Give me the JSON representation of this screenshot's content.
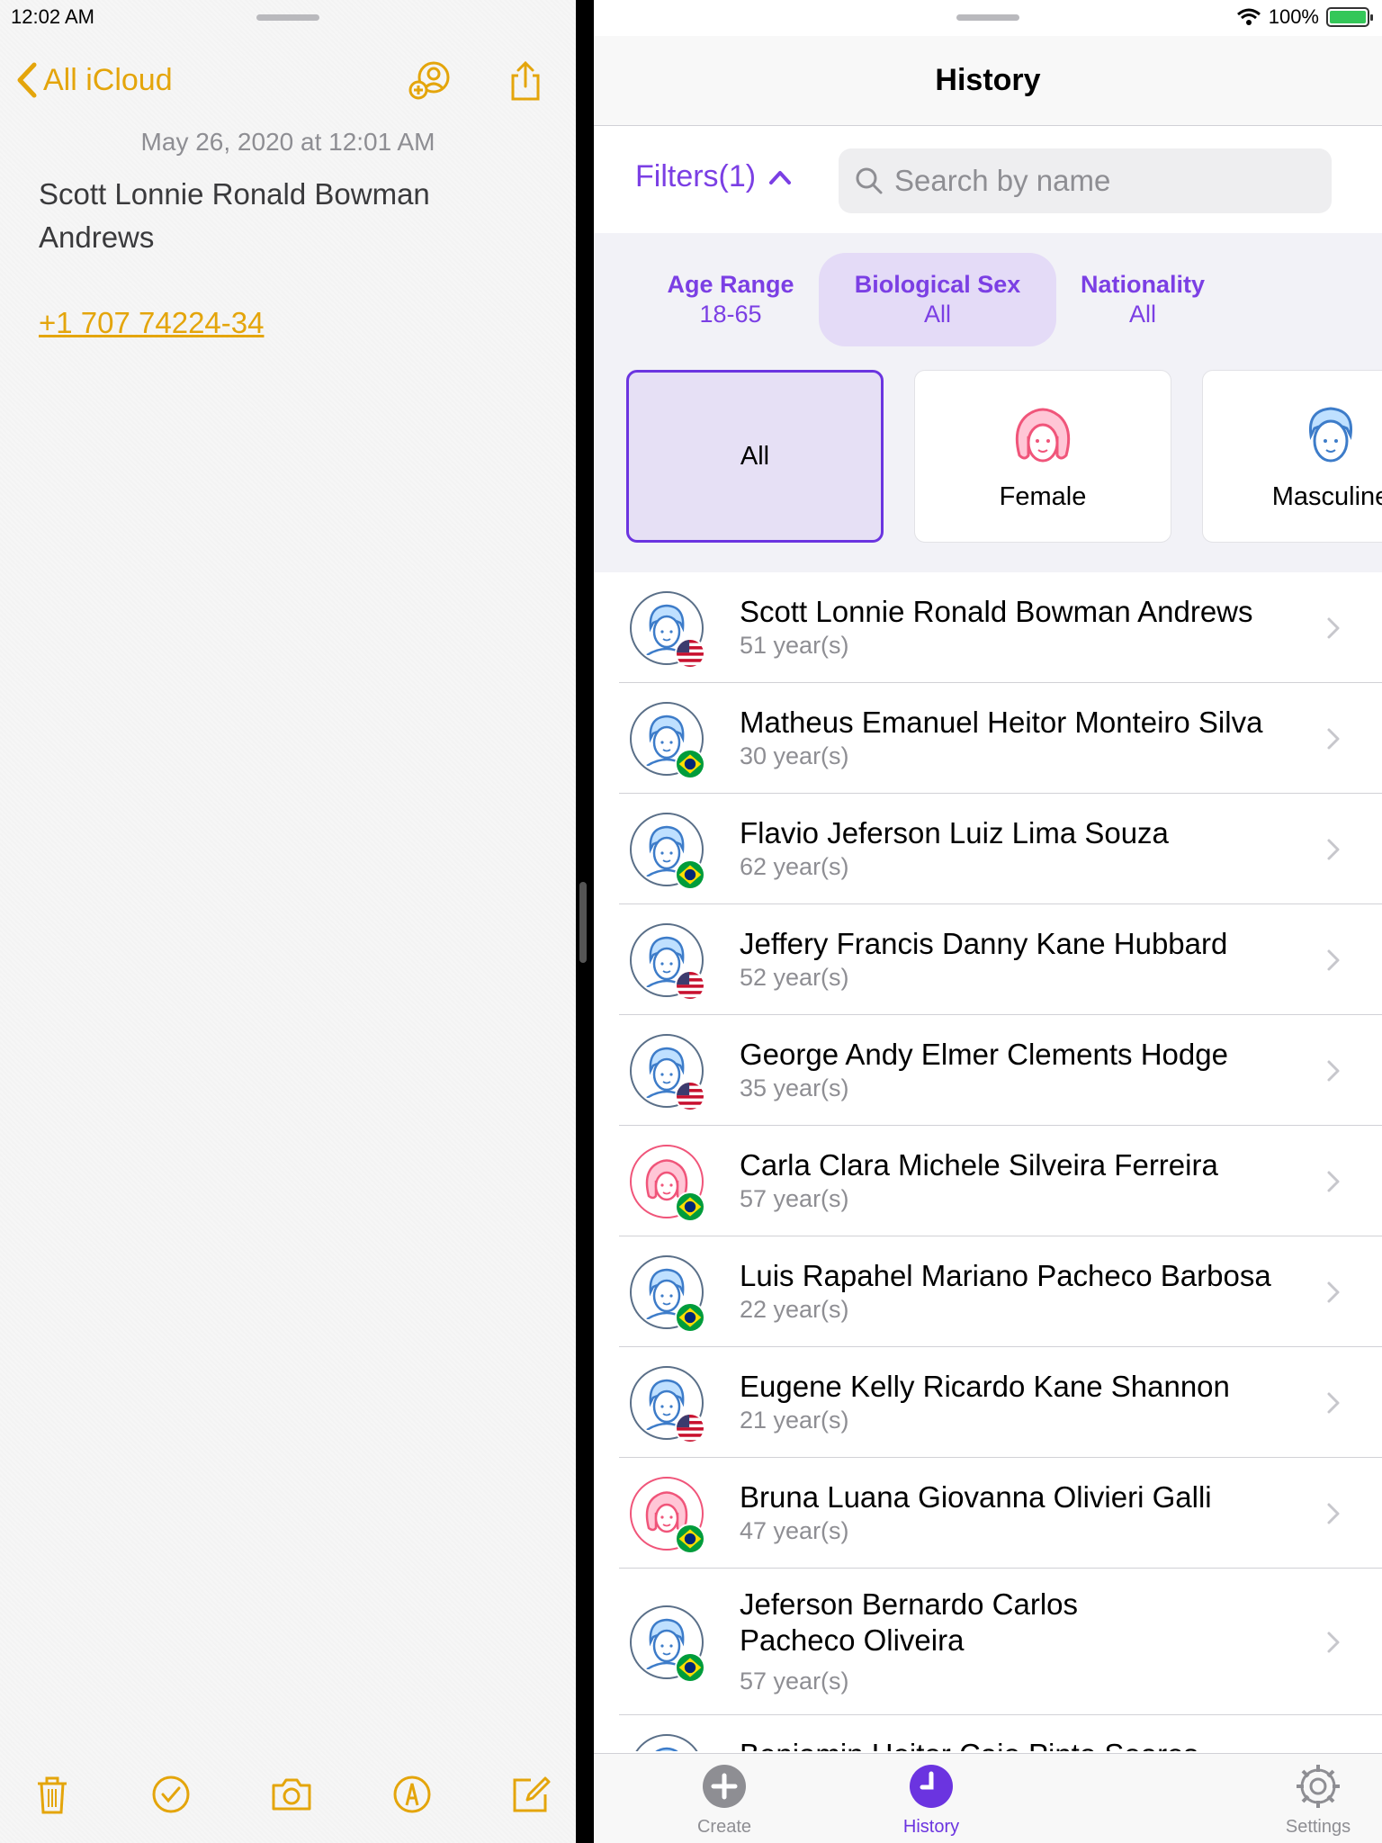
{
  "status": {
    "time": "12:02 AM",
    "battery": "100%"
  },
  "notes": {
    "back_label": "All iCloud",
    "date": "May 26, 2020 at 12:01 AM",
    "title": "Scott Lonnie Ronald Bowman Andrews",
    "phone": "+1 707 74224-34",
    "accent_color": "#e4a50b",
    "toolbar_icons": [
      "add-person-icon",
      "share-icon"
    ],
    "bottom_icons": [
      "trash-icon",
      "checklist-icon",
      "camera-icon",
      "markup-icon",
      "compose-icon"
    ]
  },
  "app": {
    "title": "History",
    "accent_color": "#6b34e0",
    "filters_label": "Filters(1)",
    "search_placeholder": "Search by name",
    "categories": [
      {
        "label": "Age Range",
        "value": "18-65",
        "active": false
      },
      {
        "label": "Biological Sex",
        "value": "All",
        "active": true
      },
      {
        "label": "Nationality",
        "value": "All",
        "active": false
      }
    ],
    "options": [
      {
        "label": "All",
        "icon": "",
        "selected": true
      },
      {
        "label": "Female",
        "icon": "female-face-icon",
        "selected": false
      },
      {
        "label": "Masculine",
        "icon": "male-face-icon",
        "selected": false
      }
    ],
    "people": [
      {
        "name": "Scott Lonnie Ronald Bowman Andrews",
        "age": "51 year(s)",
        "sex": "male",
        "flag": "us-flag-icon"
      },
      {
        "name": "Matheus Emanuel Heitor Monteiro Silva",
        "age": "30 year(s)",
        "sex": "male",
        "flag": "brazil-flag-icon"
      },
      {
        "name": "Flavio Jeferson Luiz Lima Souza",
        "age": "62 year(s)",
        "sex": "male",
        "flag": "brazil-flag-icon"
      },
      {
        "name": "Jeffery Francis Danny Kane Hubbard",
        "age": "52 year(s)",
        "sex": "male",
        "flag": "us-flag-icon"
      },
      {
        "name": "George Andy Elmer Clements Hodge",
        "age": "35 year(s)",
        "sex": "male",
        "flag": "us-flag-icon"
      },
      {
        "name": "Carla Clara Michele Silveira Ferreira",
        "age": "57 year(s)",
        "sex": "female",
        "flag": "brazil-flag-icon"
      },
      {
        "name": "Luis Rapahel Mariano Pacheco Barbosa",
        "age": "22 year(s)",
        "sex": "male",
        "flag": "brazil-flag-icon"
      },
      {
        "name": "Eugene Kelly Ricardo Kane Shannon",
        "age": "21 year(s)",
        "sex": "male",
        "flag": "us-flag-icon"
      },
      {
        "name": "Bruna Luana Giovanna Olivieri Galli",
        "age": "47 year(s)",
        "sex": "female",
        "flag": "brazil-flag-icon"
      },
      {
        "name": "Jeferson Bernardo Carlos Pacheco Oliveira",
        "age": "57 year(s)",
        "sex": "male",
        "flag": "brazil-flag-icon"
      },
      {
        "name": "Benjamin Heitor Caio Pinto Soares",
        "age": "",
        "sex": "male",
        "flag": "brazil-flag-icon"
      }
    ],
    "tabs": [
      {
        "label": "Create",
        "icon": "plus-circle-icon",
        "active": false
      },
      {
        "label": "History",
        "icon": "clock-icon",
        "active": true
      },
      {
        "label": "Settings",
        "icon": "gear-icon",
        "active": false
      }
    ]
  }
}
